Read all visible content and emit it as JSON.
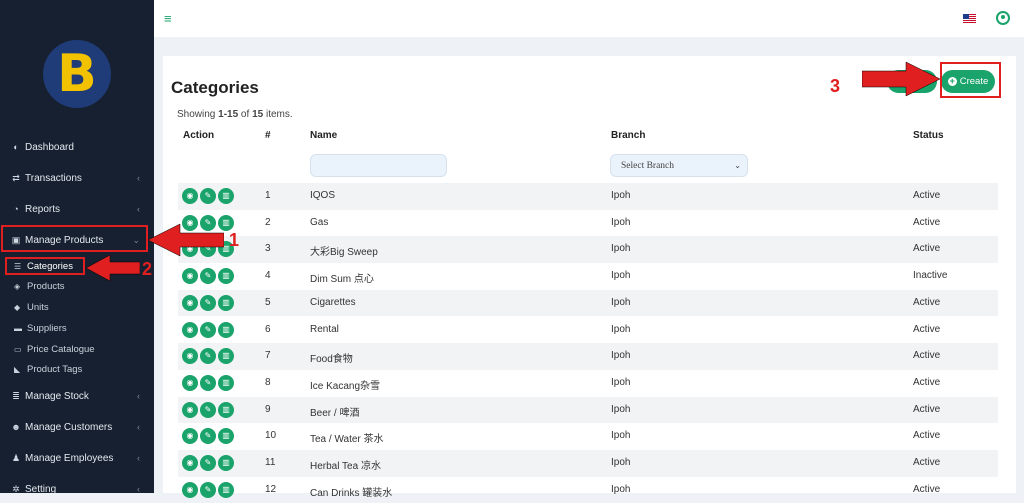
{
  "sidebar": {
    "logo_text": "B",
    "items": [
      {
        "label": "Dashboard",
        "icon": "palette-icon",
        "chevron": false
      },
      {
        "label": "Transactions",
        "icon": "exchange-icon",
        "chevron": true
      },
      {
        "label": "Reports",
        "icon": "pie-chart-icon",
        "chevron": true
      },
      {
        "label": "Manage Products",
        "icon": "box-icon",
        "chevron": true
      },
      {
        "label": "Manage Stock",
        "icon": "database-icon",
        "chevron": true
      },
      {
        "label": "Manage Customers",
        "icon": "users-icon",
        "chevron": true
      },
      {
        "label": "Manage Employees",
        "icon": "user-icon",
        "chevron": true
      },
      {
        "label": "Setting",
        "icon": "gears-icon",
        "chevron": true
      }
    ],
    "subitems": [
      {
        "label": "Categories",
        "icon": "list-icon"
      },
      {
        "label": "Products",
        "icon": "cube-icon"
      },
      {
        "label": "Units",
        "icon": "cubes-icon"
      },
      {
        "label": "Suppliers",
        "icon": "truck-icon"
      },
      {
        "label": "Price Catalogue",
        "icon": "card-icon"
      },
      {
        "label": "Product Tags",
        "icon": "tag-icon"
      }
    ]
  },
  "page": {
    "title": "Categories",
    "summary_prefix": "Showing ",
    "summary_range": "1-15",
    "summary_mid": " of ",
    "summary_total": "15",
    "summary_suffix": " items.",
    "create_label": "Create"
  },
  "table": {
    "headers": {
      "action": "Action",
      "num": "#",
      "name": "Name",
      "branch": "Branch",
      "status": "Status"
    },
    "branch_placeholder": "Select Branch",
    "rows": [
      {
        "num": "1",
        "name": "IQOS",
        "branch": "Ipoh",
        "status": "Active"
      },
      {
        "num": "2",
        "name": "Gas",
        "branch": "Ipoh",
        "status": "Active"
      },
      {
        "num": "3",
        "name": "大彩Big Sweep",
        "branch": "Ipoh",
        "status": "Active"
      },
      {
        "num": "4",
        "name": "Dim Sum 点心",
        "branch": "Ipoh",
        "status": "Inactive"
      },
      {
        "num": "5",
        "name": "Cigarettes",
        "branch": "Ipoh",
        "status": "Active"
      },
      {
        "num": "6",
        "name": "Rental",
        "branch": "Ipoh",
        "status": "Active"
      },
      {
        "num": "7",
        "name": "Food食物",
        "branch": "Ipoh",
        "status": "Active"
      },
      {
        "num": "8",
        "name": "Ice Kacang杂雪",
        "branch": "Ipoh",
        "status": "Active"
      },
      {
        "num": "9",
        "name": "Beer / 啤酒",
        "branch": "Ipoh",
        "status": "Active"
      },
      {
        "num": "10",
        "name": "Tea / Water 茶水",
        "branch": "Ipoh",
        "status": "Active"
      },
      {
        "num": "11",
        "name": "Herbal Tea 凉水",
        "branch": "Ipoh",
        "status": "Active"
      },
      {
        "num": "12",
        "name": "Can Drinks 罐装水",
        "branch": "Ipoh",
        "status": "Active"
      }
    ]
  },
  "annotations": {
    "a1": "1",
    "a2": "2",
    "a3": "3"
  },
  "colors": {
    "accent": "#1aa36a",
    "sidebar": "#172030",
    "annotation": "#e02020"
  }
}
